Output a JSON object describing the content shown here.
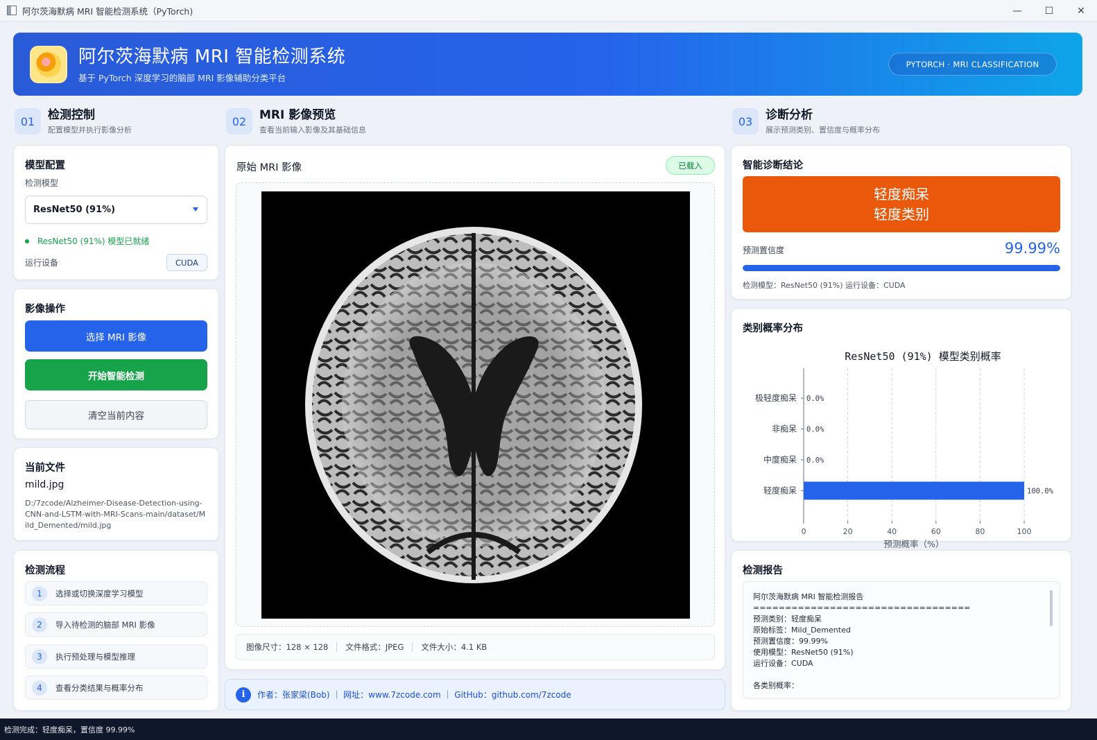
{
  "window": {
    "title": "阿尔茨海默病 MRI 智能检测系统（PyTorch)",
    "minimize": "—",
    "maximize": "☐",
    "close": "✕"
  },
  "header": {
    "title": "阿尔茨海默病 MRI 智能检测系统",
    "subtitle": "基于 PyTorch 深度学习的脑部 MRI 影像辅助分类平台",
    "pill": "PYTORCH · MRI CLASSIFICATION"
  },
  "sections": [
    {
      "num": "01",
      "title": "检测控制",
      "sub": "配置模型并执行影像分析"
    },
    {
      "num": "02",
      "title": "MRI 影像预览",
      "sub": "查看当前输入影像及其基础信息"
    },
    {
      "num": "03",
      "title": "诊断分析",
      "sub": "展示预测类别、置信度与概率分布"
    }
  ],
  "model_config": {
    "title": "模型配置",
    "model_label": "检测模型",
    "model_value": "ResNet50 (91%)",
    "status": "ResNet50 (91%) 模型已就绪",
    "device_label": "运行设备",
    "device_value": "CUDA"
  },
  "image_ops": {
    "title": "影像操作",
    "select_btn": "选择 MRI 影像",
    "detect_btn": "开始智能检测",
    "clear_btn": "清空当前内容"
  },
  "current_file": {
    "title": "当前文件",
    "name": "mild.jpg",
    "path": "D:/7zcode/Alzheimer-Disease-Detection-using-CNN-and-LSTM-with-MRI-Scans-main/dataset/Mild_Demented/mild.jpg"
  },
  "flow": {
    "title": "检测流程",
    "steps": [
      {
        "n": "1",
        "text": "选择或切换深度学习模型"
      },
      {
        "n": "2",
        "text": "导入待检测的脑部 MRI 影像"
      },
      {
        "n": "3",
        "text": "执行预处理与模型推理"
      },
      {
        "n": "4",
        "text": "查看分类结果与概率分布"
      }
    ]
  },
  "preview": {
    "title": "原始 MRI 影像",
    "badge": "已载入",
    "size": "图像尺寸：128 × 128",
    "format": "文件格式：JPEG",
    "filesize": "文件大小：4.1 KB"
  },
  "footer": {
    "icon": "i",
    "text": "作者：张家梁(Bob) ｜ 网址：www.7zcode.com ｜ GitHub：github.com/7zcode"
  },
  "diagnosis": {
    "title": "智能诊断结论",
    "result_line1": "轻度痴呆",
    "result_line2": "轻度类别",
    "result_color": "#ea580c",
    "conf_label": "预测置信度",
    "conf_value": "99.99%",
    "conf_fraction": 0.9999,
    "meta": "检测模型：ResNet50 (91%)    运行设备：CUDA"
  },
  "prob_card": {
    "title": "类别概率分布"
  },
  "chart_data": {
    "type": "bar",
    "orientation": "horizontal",
    "title": "ResNet50 (91%) 模型类别概率",
    "xlabel": "预测概率（%）",
    "ylabel": "",
    "categories": [
      "极轻度痴呆",
      "非痴呆",
      "中度痴呆",
      "轻度痴呆"
    ],
    "values": [
      0.0,
      0.0,
      0.0,
      100.0
    ],
    "value_labels": [
      "0.0%",
      "0.0%",
      "0.0%",
      "100.0%"
    ],
    "xlim": [
      0,
      100
    ],
    "xticks": [
      "0",
      "20",
      "40",
      "60",
      "80",
      "100"
    ],
    "grid": true,
    "bar_color": "#2563eb"
  },
  "report": {
    "title": "检测报告",
    "lines": [
      "阿尔茨海默病 MRI 智能检测报告",
      "==================================",
      "预测类别：轻度痴呆",
      "原始标签：Mild_Demented",
      "预测置信度：99.99%",
      "使用模型：ResNet50 (91%)",
      "运行设备：CUDA",
      "",
      "各类别概率："
    ]
  },
  "statusbar": {
    "text": "检测完成：轻度痴呆，置信度 99.99%"
  }
}
